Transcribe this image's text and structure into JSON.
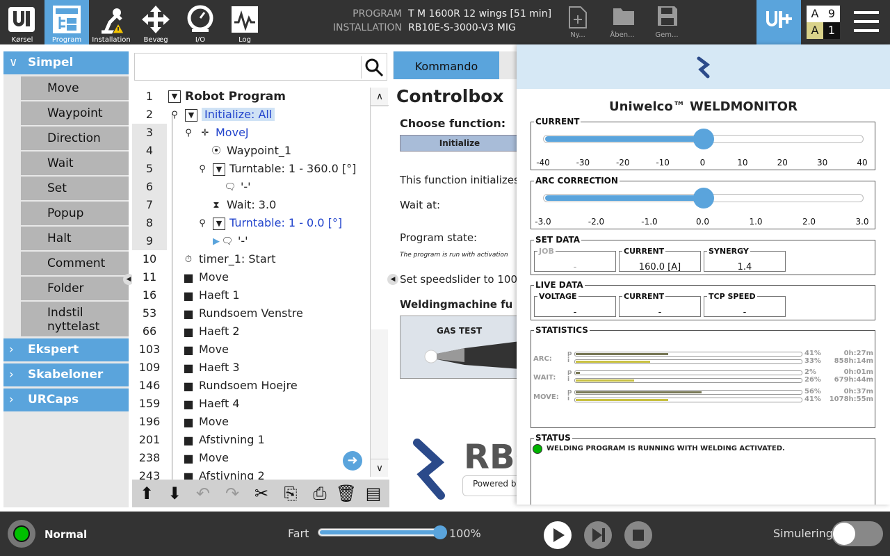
{
  "nav": [
    {
      "label": "Kørsel",
      "icon": "ur-logo-icon"
    },
    {
      "label": "Program",
      "icon": "program-icon"
    },
    {
      "label": "Installation",
      "icon": "installation-icon"
    },
    {
      "label": "Bevæg",
      "icon": "move-arrows-icon"
    },
    {
      "label": "I/O",
      "icon": "io-icon"
    },
    {
      "label": "Log",
      "icon": "log-icon"
    }
  ],
  "header": {
    "program_label": "PROGRAM",
    "program_value": "T M 1600R 12 wings [51 min]",
    "installation_label": "INSTALLATION",
    "installation_value": "RB10E-S-3000-V3 MIG",
    "file_buttons": [
      "Ny...",
      "Åben...",
      "Gem..."
    ],
    "counters": {
      "top_letter": "A",
      "top_value": "9",
      "bottom_letter": "A",
      "bottom_value": "1"
    }
  },
  "left": {
    "simpel": "Simpel",
    "nodes": [
      "Move",
      "Waypoint",
      "Direction",
      "Wait",
      "Set",
      "Popup",
      "Halt",
      "Comment",
      "Folder",
      "Indstil nyttelast"
    ],
    "ekspert": "Ekspert",
    "skabeloner": "Skabeloner",
    "urcaps": "URCaps"
  },
  "tree": {
    "line_numbers": [
      "1",
      "2",
      "3",
      "4",
      "5",
      "6",
      "7",
      "8",
      "9",
      "10",
      "11",
      "16",
      "53",
      "66",
      "103",
      "109",
      "146",
      "159",
      "196",
      "201",
      "238",
      "243"
    ],
    "rows": [
      {
        "text": "Robot Program"
      },
      {
        "text": "Initialize: All"
      },
      {
        "text": "MoveJ"
      },
      {
        "text": "Waypoint_1"
      },
      {
        "text": "Turntable: 1 - 360.0 [°]"
      },
      {
        "text": "'-'"
      },
      {
        "text": "Wait: 3.0"
      },
      {
        "text": "Turntable: 1 - 0.0 [°]"
      },
      {
        "text": "'-'"
      },
      {
        "text": "timer_1: Start"
      },
      {
        "text": "Move"
      },
      {
        "text": "Haeft 1"
      },
      {
        "text": "Rundsoem Venstre"
      },
      {
        "text": "Haeft 2"
      },
      {
        "text": "Move"
      },
      {
        "text": "Haeft 3"
      },
      {
        "text": "Rundsoem Hoejre"
      },
      {
        "text": "Haeft 4"
      },
      {
        "text": "Move"
      },
      {
        "text": "Afstivning 1"
      },
      {
        "text": "Move"
      },
      {
        "text": "Afstivning 2"
      }
    ]
  },
  "middle": {
    "tab": "Kommando",
    "title": "Controlbox",
    "choose": "Choose function:",
    "initialize_btn": "Initialize",
    "desc": "This function initializes",
    "wait_at": "Wait at:",
    "prog_state": "Program state:",
    "note": "The program is run with activation",
    "speedslider": "Set speedslider to 100",
    "weldingmachine": "Weldingmachine fu",
    "gas_test": "GAS TEST",
    "logo_text": "RBC",
    "powered": "Powered by"
  },
  "wm": {
    "title": "Uniwelco™ WELDMONITOR",
    "current_title": "CURRENT",
    "current_ticks": [
      "-40",
      "-30",
      "-20",
      "-10",
      "0",
      "10",
      "20",
      "30",
      "40"
    ],
    "current_value": 0,
    "arc_title": "ARC CORRECTION",
    "arc_ticks": [
      "-3.0",
      "-2.0",
      "-1.0",
      "0.0",
      "1.0",
      "2.0",
      "3.0"
    ],
    "arc_value": 0.0,
    "set_data": "SET DATA",
    "job_label": "JOB",
    "job_value": "-",
    "set_current_label": "CURRENT",
    "set_current_value": "160.0 [A]",
    "synergy_label": "SYNERGY",
    "synergy_value": "1.4",
    "live_data": "LIVE DATA",
    "voltage_label": "VOLTAGE",
    "voltage_value": "-",
    "live_current_label": "CURRENT",
    "live_current_value": "-",
    "tcp_label": "TCP SPEED",
    "tcp_value": "-",
    "statistics": "STATISTICS",
    "stats": [
      {
        "label": "ARC:",
        "p_pct": "41%",
        "p_frac": 0.41,
        "p_dur": "0h:27m",
        "i_pct": "33%",
        "i_frac": 0.33,
        "i_dur": "858h:14m"
      },
      {
        "label": "WAIT:",
        "p_pct": "2%",
        "p_frac": 0.02,
        "p_dur": "0h:01m",
        "i_pct": "26%",
        "i_frac": 0.26,
        "i_dur": "679h:44m"
      },
      {
        "label": "MOVE:",
        "p_pct": "56%",
        "p_frac": 0.56,
        "p_dur": "0h:37m",
        "i_pct": "41%",
        "i_frac": 0.41,
        "i_dur": "1078h:55m"
      }
    ],
    "p": "p",
    "i": "i",
    "status": "STATUS",
    "status_text": "WELDING PROGRAM IS RUNNING WITH WELDING ACTIVATED."
  },
  "bottom": {
    "mode": "Normal",
    "speed_label": "Fart",
    "speed_value": "100%",
    "speed_frac": 1.0,
    "simulation": "Simulering"
  },
  "colors": {
    "accent": "#5aa4dc",
    "topbar": "#333333",
    "status_green": "#00b300",
    "stat_p": "#777755",
    "stat_i": "#c8c040"
  }
}
